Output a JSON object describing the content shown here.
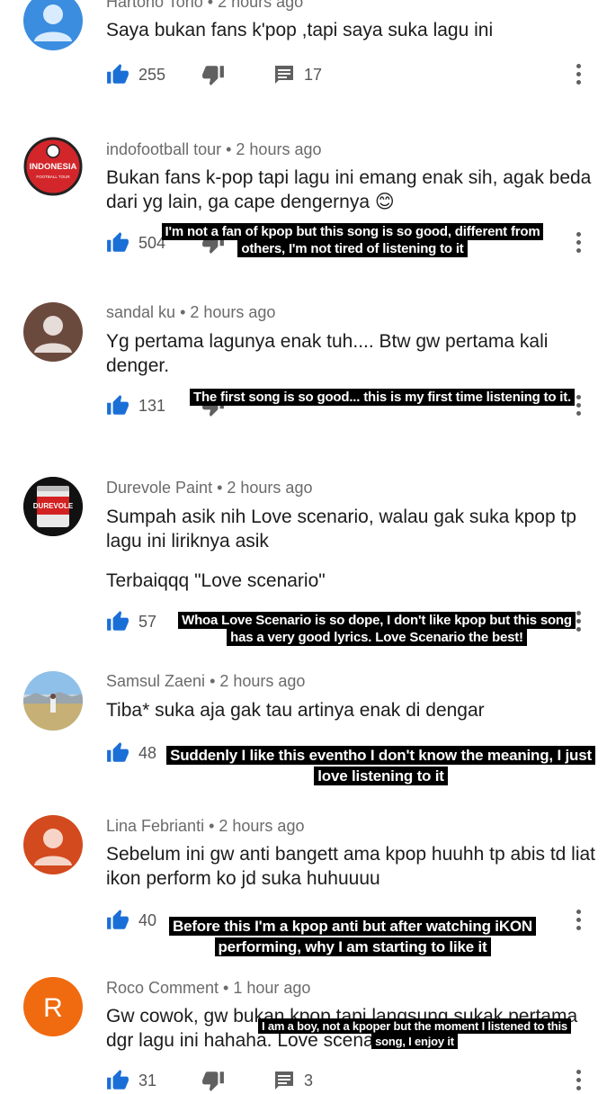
{
  "comments": [
    {
      "author": "Hartono Tono",
      "time": "2 hours ago",
      "lines": [
        "Saya bukan fans k'pop ,tapi saya suka lagu ini"
      ],
      "likes": "255",
      "replies": "17",
      "avatar_color": "#3b8de0"
    },
    {
      "author": "indofootball tour",
      "time": "2 hours ago",
      "lines": [
        "Bukan fans k-pop tapi lagu ini emang enak sih, agak beda",
        "dari yg lain, ga cape dengernya 😊"
      ],
      "likes": "504",
      "logo_text": "INDONESIA",
      "logo_sub": "FOOTBALL TOUR",
      "caption": [
        "I'm not a fan of kpop but this song is so good, different from",
        "others, I'm not tired of listening to it"
      ]
    },
    {
      "author": "sandal ku",
      "time": "2 hours ago",
      "lines": [
        "Yg pertama lagunya enak tuh.... Btw gw pertama kali",
        "denger."
      ],
      "likes": "131",
      "avatar_color": "#6b4a3e",
      "caption": [
        "The first song is so good... this is my first time listening to it."
      ]
    },
    {
      "author": "Durevole Paint",
      "time": "2 hours ago",
      "lines": [
        "Sumpah asik nih Love scenario, walau gak suka kpop tp",
        "lagu ini liriknya asik",
        "",
        "Terbaiqqq \"Love scenario\""
      ],
      "likes": "57",
      "can_label": "DUREVOLE",
      "caption": [
        "Whoa Love Scenario is so dope, I don't like kpop but this song",
        "has a very good lyrics. Love Scenario the best!"
      ]
    },
    {
      "author": "Samsul Zaeni",
      "time": "2 hours ago",
      "lines": [
        "Tiba* suka aja gak tau artinya enak di dengar"
      ],
      "likes": "48",
      "caption": [
        "Suddenly I like this eventho I don't know the meaning, I just",
        "love listening to it"
      ]
    },
    {
      "author": "Lina Febrianti",
      "time": "2 hours ago",
      "lines": [
        "Sebelum ini gw anti bangett ama kpop huuhh tp abis td liat",
        "ikon perform ko jd suka huhuuuu"
      ],
      "likes": "40",
      "avatar_color": "#d24a1e",
      "caption": [
        "Before this I'm a kpop anti but after watching iKON",
        "performing, why I am starting to like it"
      ]
    },
    {
      "author": "Roco Comment",
      "time": "1 hour ago",
      "lines": [
        "Gw cowok, gw bukan kpop tapi langsung sukak pertama",
        "dgr lagu ini hahaha. Love scenario kkkw"
      ],
      "likes": "31",
      "replies": "3",
      "avatar_letter": "R",
      "avatar_color": "#f06a0f",
      "caption": [
        "I am a boy, not a kpoper but the moment I listened to this",
        "song, I enjoy it"
      ]
    }
  ]
}
